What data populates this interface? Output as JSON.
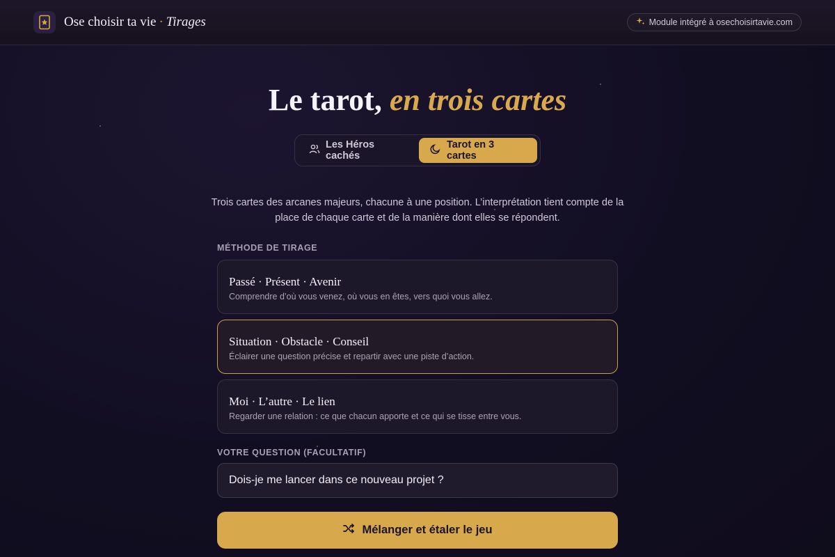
{
  "header": {
    "brand_name": "Ose choisir ta vie",
    "brand_separator": "·",
    "brand_sub": "Tirages",
    "badge_text": "Module intégré à osechoisirtavie.com"
  },
  "hero": {
    "title_main": "Le tarot,",
    "title_accent": "en trois cartes"
  },
  "tabs": [
    {
      "label": "Les Héros cachés",
      "icon": "users-icon",
      "active": false
    },
    {
      "label": "Tarot en 3 cartes",
      "icon": "moon-icon",
      "active": true
    }
  ],
  "intro": "Trois cartes des arcanes majeurs, chacune à une position. L’interprétation tient compte de la place de chaque carte et de la manière dont elles se répondent.",
  "methods_label": "MÉTHODE DE TIRAGE",
  "methods": [
    {
      "title": "Passé · Présent · Avenir",
      "desc": "Comprendre d’où vous venez, où vous en êtes, vers quoi vous allez.",
      "selected": false
    },
    {
      "title": "Situation · Obstacle · Conseil",
      "desc": "Éclairer une question précise et repartir avec une piste d’action.",
      "selected": true
    },
    {
      "title": "Moi · L’autre · Le lien",
      "desc": "Regarder une relation : ce que chacun apporte et ce qui se tisse entre vous.",
      "selected": false
    }
  ],
  "question": {
    "label": "VOTRE QUESTION (FACULTATIF)",
    "value": "Dois-je me lancer dans ce nouveau projet ?"
  },
  "cta_label": "Mélanger et étaler le jeu",
  "colors": {
    "accent": "#d7a84c",
    "background": "#120e22"
  }
}
